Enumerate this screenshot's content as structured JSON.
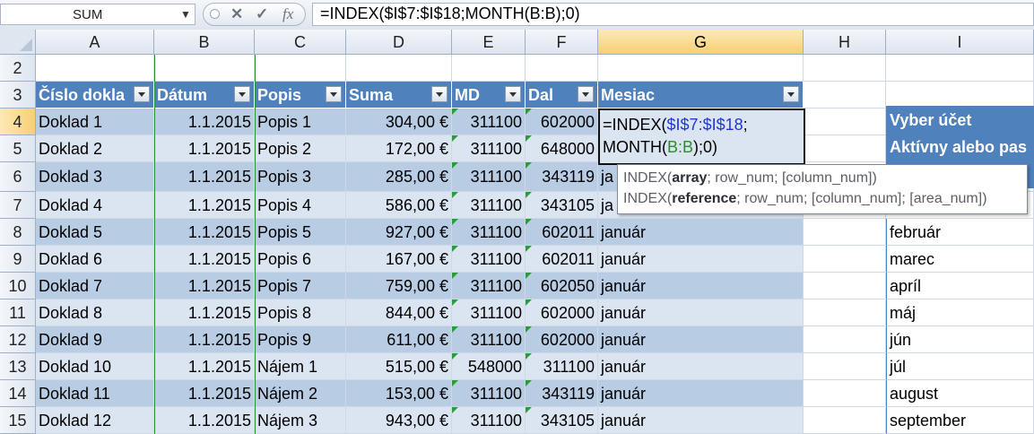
{
  "formula_bar": {
    "name_box": "SUM",
    "cancel_icon": "✕",
    "enter_icon": "✓",
    "fx_label": "fx",
    "formula": "=INDEX($I$7:$I$18;MONTH(B:B);0)"
  },
  "columns": [
    "A",
    "B",
    "C",
    "D",
    "E",
    "F",
    "G",
    "H",
    "I"
  ],
  "rows": [
    "2",
    "3",
    "4",
    "5",
    "6",
    "7",
    "8",
    "9",
    "10",
    "11",
    "12",
    "13",
    "14",
    "15"
  ],
  "table_headers": [
    "Číslo dokla",
    "Dátum",
    "Popis",
    "Suma",
    "MD",
    "Dal",
    "Mesiac"
  ],
  "table_rows": [
    {
      "row": "4",
      "a": "Doklad 1",
      "b": "1.1.2015",
      "c": "Popis 1",
      "d": "304,00 €",
      "e": "311100",
      "f": "602000",
      "g": ""
    },
    {
      "row": "5",
      "a": "Doklad 2",
      "b": "1.1.2015",
      "c": "Popis 2",
      "d": "172,00 €",
      "e": "311100",
      "f": "648000",
      "g": ""
    },
    {
      "row": "6",
      "a": "Doklad 3",
      "b": "1.1.2015",
      "c": "Popis 3",
      "d": "285,00 €",
      "e": "311100",
      "f": "343119",
      "g": "ja"
    },
    {
      "row": "7",
      "a": "Doklad 4",
      "b": "1.1.2015",
      "c": "Popis 4",
      "d": "586,00 €",
      "e": "311100",
      "f": "343105",
      "g": "ja"
    },
    {
      "row": "8",
      "a": "Doklad 5",
      "b": "1.1.2015",
      "c": "Popis 5",
      "d": "927,00 €",
      "e": "311100",
      "f": "602011",
      "g": "január"
    },
    {
      "row": "9",
      "a": "Doklad 6",
      "b": "1.1.2015",
      "c": "Popis 6",
      "d": "167,00 €",
      "e": "311100",
      "f": "602011",
      "g": "január"
    },
    {
      "row": "10",
      "a": "Doklad 7",
      "b": "1.1.2015",
      "c": "Popis 7",
      "d": "759,00 €",
      "e": "311100",
      "f": "602050",
      "g": "január"
    },
    {
      "row": "11",
      "a": "Doklad 8",
      "b": "1.1.2015",
      "c": "Popis 8",
      "d": "844,00 €",
      "e": "311100",
      "f": "602000",
      "g": "január"
    },
    {
      "row": "12",
      "a": "Doklad 9",
      "b": "1.1.2015",
      "c": "Popis 9",
      "d": "611,00 €",
      "e": "311100",
      "f": "602000",
      "g": "január"
    },
    {
      "row": "13",
      "a": "Doklad 10",
      "b": "1.1.2015",
      "c": "Nájem 1",
      "d": "515,00 €",
      "e": "548000",
      "f": "311100",
      "g": "január"
    },
    {
      "row": "14",
      "a": "Doklad 11",
      "b": "1.1.2015",
      "c": "Nájem 2",
      "d": "153,00 €",
      "e": "311100",
      "f": "343119",
      "g": "január"
    },
    {
      "row": "15",
      "a": "Doklad 12",
      "b": "1.1.2015",
      "c": "Nájem 3",
      "d": "943,00 €",
      "e": "311100",
      "f": "343105",
      "g": "január"
    }
  ],
  "edit_cell": {
    "line1_prefix": "=INDEX(",
    "line1_ref": "$I$7:$I$18",
    "line1_suffix": ";",
    "line2_prefix": "MONTH(",
    "line2_ref": "B:B",
    "line2_suffix": ");0)"
  },
  "column_i": {
    "header_box": [
      "Vyber účet",
      "Aktívny alebo pas"
    ],
    "months": [
      {
        "row": "8",
        "label": "február"
      },
      {
        "row": "9",
        "label": "marec"
      },
      {
        "row": "10",
        "label": "apríl"
      },
      {
        "row": "11",
        "label": "máj"
      },
      {
        "row": "12",
        "label": "jún"
      },
      {
        "row": "13",
        "label": "júl"
      },
      {
        "row": "14",
        "label": "august"
      },
      {
        "row": "15",
        "label": "september"
      }
    ]
  },
  "tooltip": {
    "line1": {
      "fn": "INDEX(",
      "bold": "array",
      "rest": "; row_num; [column_num])"
    },
    "line2": {
      "fn": "INDEX(",
      "bold": "reference",
      "rest": "; row_num; [column_num]; [area_num])"
    }
  },
  "colors": {
    "table_header": "#4f81bd",
    "band_dark": "#b8cce4",
    "band_light": "#dbe5f1",
    "selected_header": "#f7cf72",
    "error_triangle": "#2a9d3a",
    "ref_blue": "#1f37d0",
    "ref_green": "#2e8b2e"
  }
}
